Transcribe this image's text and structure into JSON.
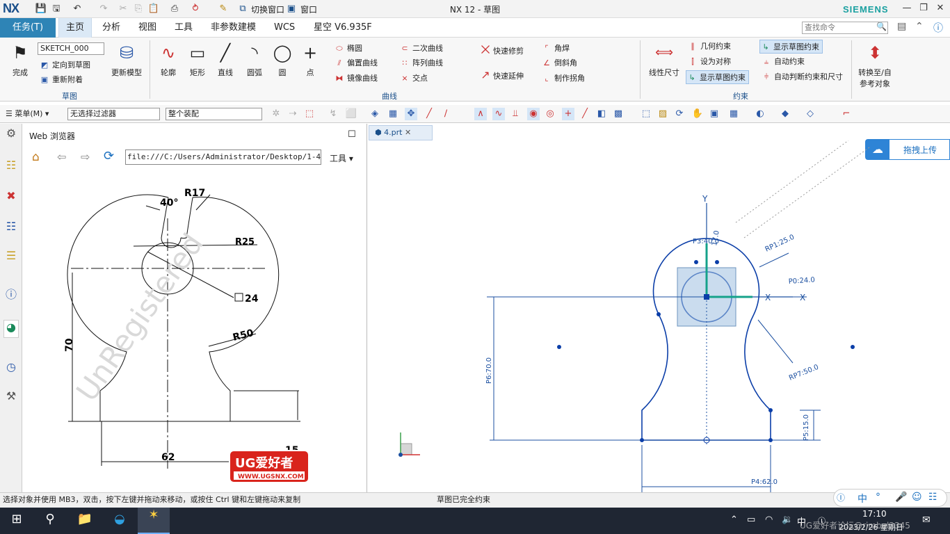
{
  "titlebar": {
    "logo": "NX",
    "title": "NX 12 - 草图",
    "brand": "SIEMENS",
    "switch_window": "切换窗口",
    "window_menu": "窗口"
  },
  "menubar": {
    "task_tab": "任务(T)",
    "tabs": [
      "主页",
      "分析",
      "视图",
      "工具",
      "非参数建模",
      "WCS",
      "星空 V6.935F"
    ],
    "search_placeholder": "查找命令"
  },
  "ribbon": {
    "finish": "完成",
    "sketch_name": "SKETCH_000",
    "orient_to_sketch": "定向到草图",
    "reattach": "重新附着",
    "update_model": "更新模型",
    "group_sketch": "草图",
    "profile": "轮廓",
    "rectangle": "矩形",
    "line": "直线",
    "arc": "圆弧",
    "circle": "圆",
    "point": "点",
    "ellipse": "椭圆",
    "offset_curve": "偏置曲线",
    "mirror_curve": "镜像曲线",
    "conic": "二次曲线",
    "pattern_curve": "阵列曲线",
    "intersection": "交点",
    "quick_trim": "快速修剪",
    "quick_extend": "快速延伸",
    "fillet": "角焊",
    "chamfer": "倒斜角",
    "make_corner": "制作拐角",
    "group_curve": "曲线",
    "linear_dim": "线性尺寸",
    "geo_constraint": "几何约束",
    "make_symmetric": "设为对称",
    "show_sketch_constraint": "显示草图约束",
    "show_sketch_constraint2": "显示草图约束",
    "auto_constrain": "自动约束",
    "auto_dim": "自动判断约束和尺寸",
    "group_constraint": "约束",
    "convert_ref": "转换至/自参考对象"
  },
  "toolbar2": {
    "menu": "菜单(M)",
    "filter": "无选择过滤器",
    "assembly": "整个装配"
  },
  "web": {
    "title": "Web 浏览器",
    "url": "file:///C:/Users/Administrator/Desktop/1-4.png",
    "tools": "工具",
    "drawing": {
      "d40": "40°",
      "r17": "R17",
      "r25": "R25",
      "sq24": "24",
      "r50": "R50",
      "h70": "70",
      "w62": "62",
      "h15": "15",
      "watermark": "UnRegistered",
      "logo_text": "UG爱好者",
      "logo_url": "WWW.UGSNX.COM"
    }
  },
  "graphics": {
    "tab": "4.prt",
    "upload": "拖拽上传",
    "dims": {
      "p3": "P3:40.0",
      "p2": "17.0",
      "p1": "RP1:25.0",
      "p0": "P0:24.0",
      "p6": "P6:70.0",
      "p7": "RP7:50.0",
      "p5": "P5:15.0",
      "p4": "P4:62.0"
    },
    "axes": {
      "y": "Y",
      "x": "X",
      "x2": "X"
    }
  },
  "status": {
    "hint": "选择对象并使用 MB3，双击，按下左键并拖动来移动，或按住 Ctrl 键和左键拖动来复制",
    "state": "草图已完全约束"
  },
  "taskbar": {
    "time": "17:10",
    "date": "2023/2/26 星期日",
    "ime": "中",
    "overlay_text": "UG爱好者论坛@rimbal2345"
  }
}
